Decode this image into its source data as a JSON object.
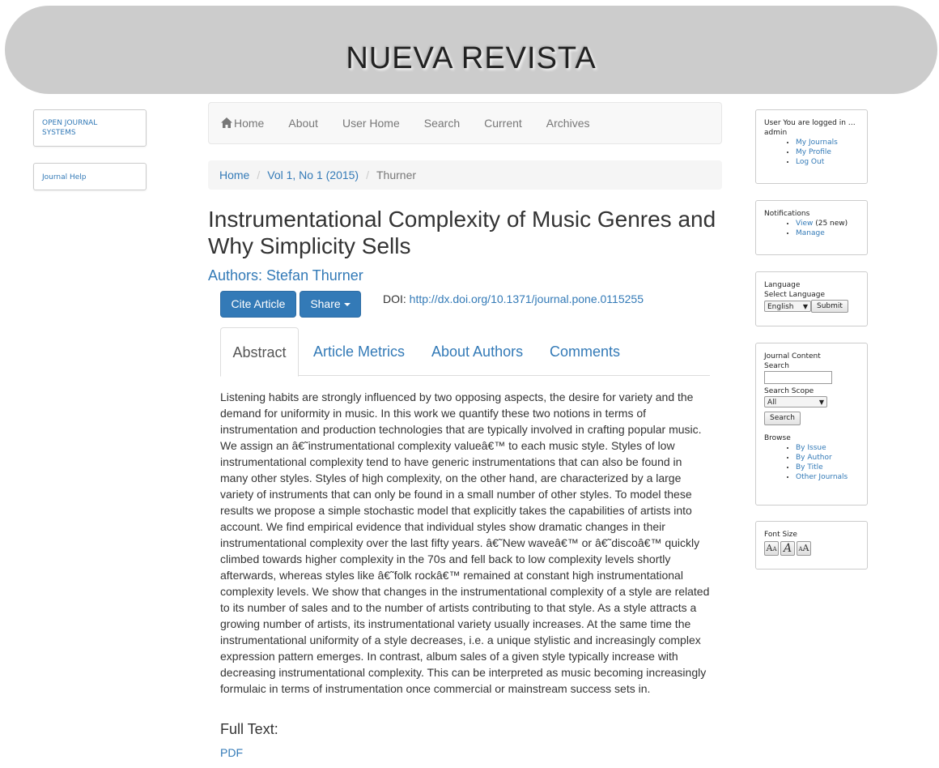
{
  "header": {
    "site_title": "NUEVA REVISTA"
  },
  "left_sidebar": {
    "ojs_link": "OPEN JOURNAL SYSTEMS",
    "help_link": "Journal Help"
  },
  "navbar": {
    "items": [
      "Home",
      "About",
      "User Home",
      "Search",
      "Current",
      "Archives"
    ]
  },
  "breadcrumb": {
    "items": [
      "Home",
      "Vol 1, No 1 (2015)",
      "Thurner"
    ]
  },
  "article": {
    "title": "Instrumentational Complexity of Music Genres and Why Simplicity Sells",
    "authors": "Authors: Stefan Thurner",
    "cite_button": "Cite Article",
    "share_button": "Share",
    "doi_label": "DOI:",
    "doi_link": "http://dx.doi.org/10.1371/journal.pone.0115255",
    "tabs": [
      "Abstract",
      "Article Metrics",
      "About Authors",
      "Comments"
    ],
    "abstract": "Listening habits are strongly influenced by two opposing aspects, the desire for variety and the demand for uniformity in music. In this work we quantify these two notions in terms of instrumentation and production technologies that are typically involved in crafting popular music. We assign an â€˜instrumentational complexity valueâ€™ to each music style. Styles of low instrumentational complexity tend to have generic instrumentations that can also be found in many other styles. Styles of high complexity, on the other hand, are characterized by a large variety of instruments that can only be found in a small number of other styles. To model these results we propose a simple stochastic model that explicitly takes the capabilities of artists into account. We find empirical evidence that individual styles show dramatic changes in their instrumentational complexity over the last fifty years. â€˜New waveâ€™ or â€˜discoâ€™ quickly climbed towards higher complexity in the 70s and fell back to low complexity levels shortly afterwards, whereas styles like â€˜folk rockâ€™ remained at constant high instrumentational complexity levels. We show that changes in the instrumentational complexity of a style are related to its number of sales and to the number of artists contributing to that style. As a style attracts a growing number of artists, its instrumentational variety usually increases. At the same time the instrumentational uniformity of a style decreases, i.e. a unique stylistic and increasingly complex expression pattern emerges. In contrast, album sales of a given style typically increase with decreasing instrumentational complexity. This can be interpreted as music becoming increasingly formulaic in terms of instrumentation once commercial or mainstream success sets in.",
    "fulltext_heading": "Full Text:",
    "pdf_link": "PDF"
  },
  "right_sidebar": {
    "user": {
      "logged_in_text": "User You are logged in as...",
      "username": "admin",
      "links": [
        "My Journals",
        "My Profile",
        "Log Out"
      ]
    },
    "notifications": {
      "title": "Notifications",
      "view_link": "View",
      "view_count": " (25 new)",
      "manage_link": "Manage"
    },
    "language": {
      "title": "Language",
      "select_label": "Select Language",
      "selected": "English",
      "submit": "Submit"
    },
    "journal_content": {
      "title": "Journal Content",
      "search_label": "Search",
      "scope_label": "Search Scope",
      "scope_selected": "All",
      "search_button": "Search",
      "browse_label": "Browse",
      "browse_links": [
        "By Issue",
        "By Author",
        "By Title",
        "Other Journals"
      ]
    },
    "font_size": {
      "title": "Font Size"
    }
  },
  "icons": [
    "home-icon",
    "caret-down-icon",
    "font-smaller-icon",
    "font-default-icon",
    "font-larger-icon"
  ]
}
